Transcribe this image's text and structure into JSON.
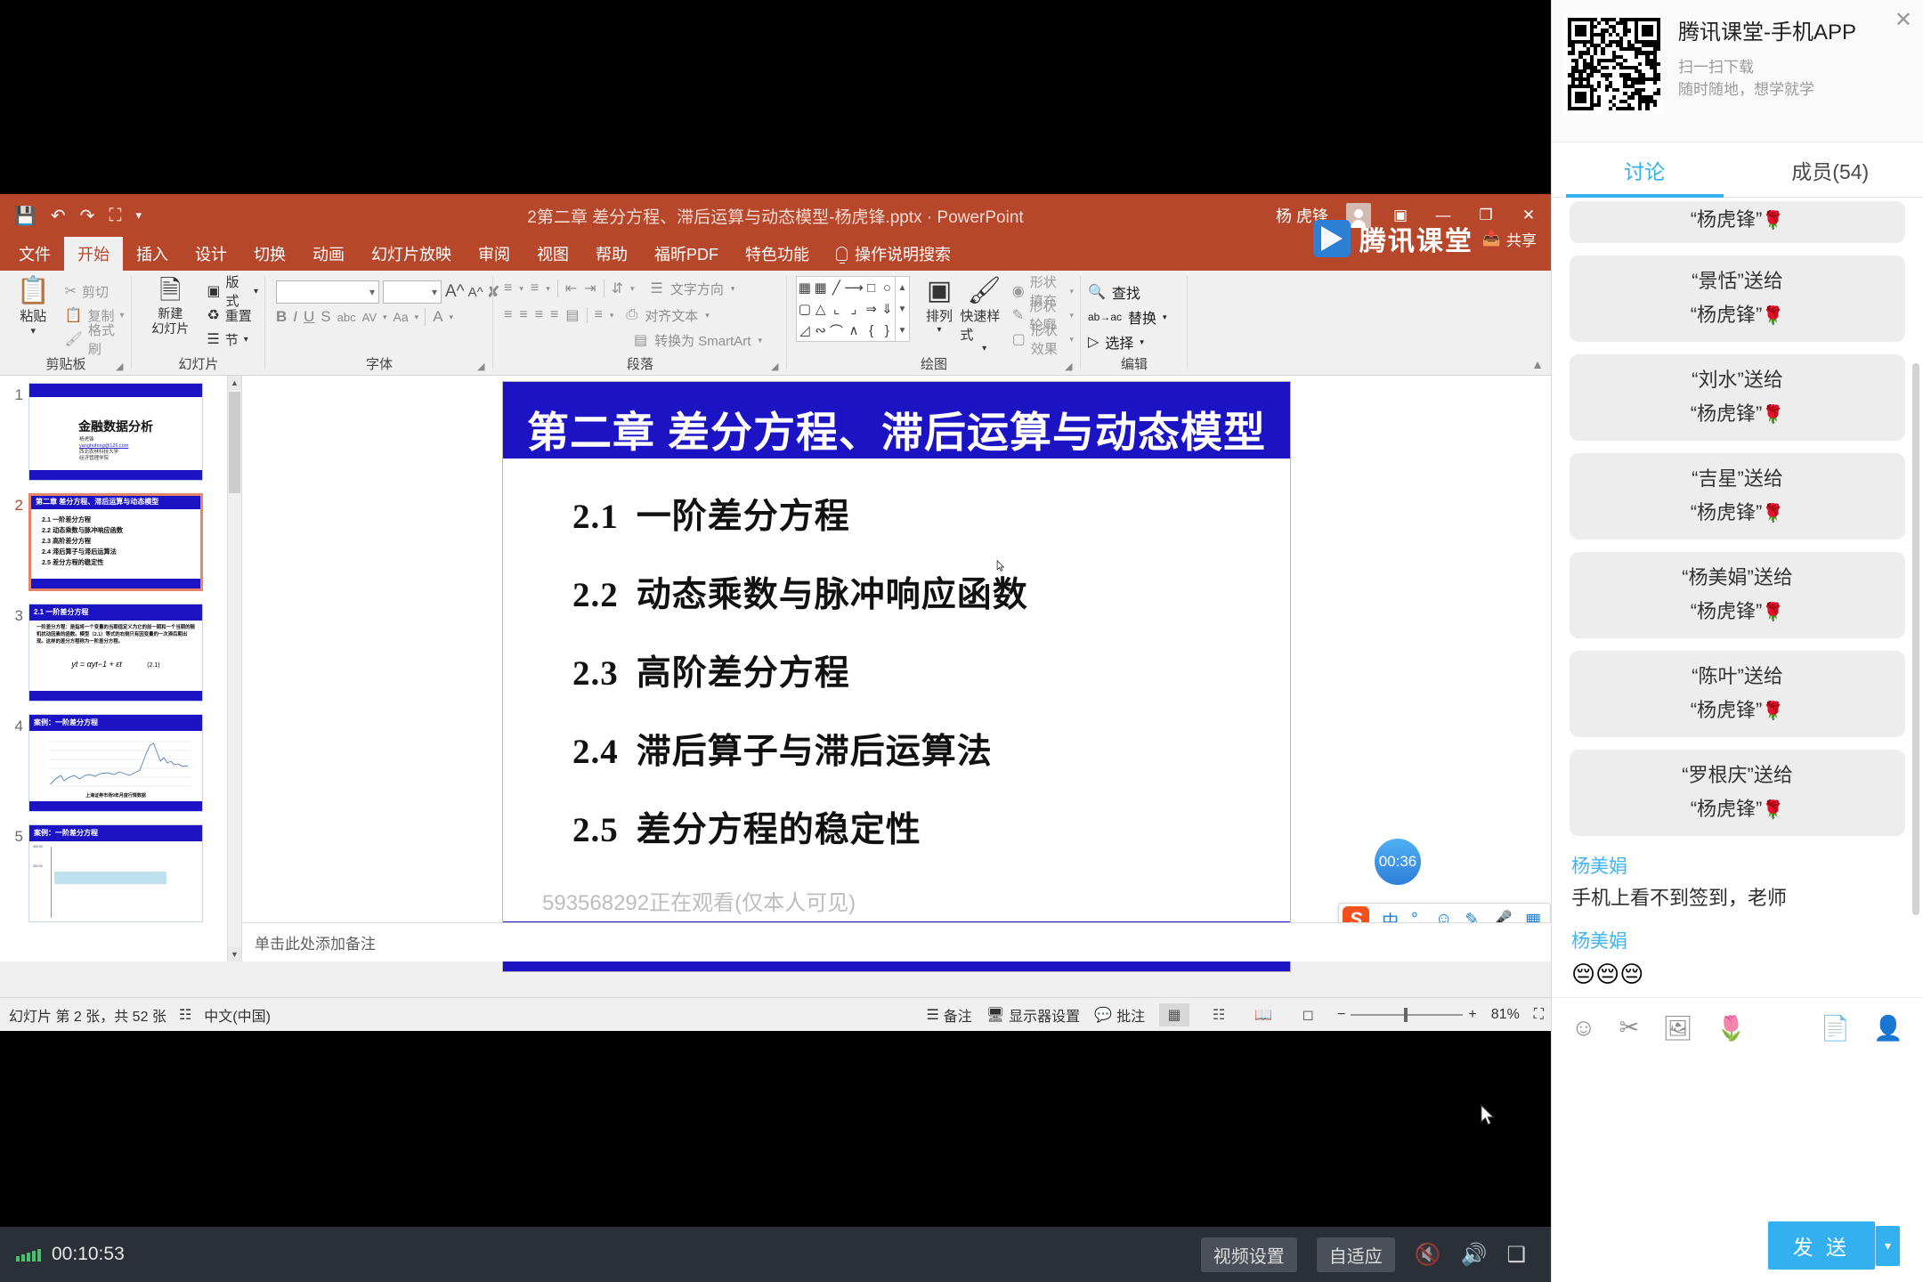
{
  "app": {
    "ppt_title": "2第二章 差分方程、滞后运算与动态模型-杨虎锋.pptx  ·  PowerPoint",
    "account_name": "杨 虎锋",
    "share_label": "共享",
    "brand_name": "腾讯课堂",
    "quick_access": [
      "save-icon",
      "undo-icon",
      "redo-icon",
      "present-icon",
      "customize-icon"
    ],
    "window_buttons": {
      "restore_down": "❐",
      "minimize": "—",
      "maximize": "❐",
      "close": "✕"
    }
  },
  "ribbon": {
    "tabs": [
      {
        "label": "文件",
        "active": false
      },
      {
        "label": "开始",
        "active": true
      },
      {
        "label": "插入",
        "active": false
      },
      {
        "label": "设计",
        "active": false
      },
      {
        "label": "切换",
        "active": false
      },
      {
        "label": "动画",
        "active": false
      },
      {
        "label": "幻灯片放映",
        "active": false
      },
      {
        "label": "审阅",
        "active": false
      },
      {
        "label": "视图",
        "active": false
      },
      {
        "label": "帮助",
        "active": false
      },
      {
        "label": "福昕PDF",
        "active": false
      },
      {
        "label": "特色功能",
        "active": false
      }
    ],
    "tell_me": "操作说明搜索",
    "groups": {
      "clipboard": {
        "label": "剪贴板",
        "paste": "粘贴",
        "cut": "剪切",
        "copy": "复制",
        "format_painter": "格式刷"
      },
      "slides": {
        "label": "幻灯片",
        "new_slide": "新建\n幻灯片",
        "new_slide_line1": "新建",
        "new_slide_line2": "幻灯片",
        "layout": "版式",
        "reset": "重置",
        "section": "节"
      },
      "font": {
        "label": "字体",
        "font_name_value": "",
        "font_size_value": "",
        "bold": "B",
        "italic": "I",
        "underline": "U",
        "shadow": "S",
        "strikethrough": "abc",
        "char_spacing": "AV",
        "change_case": "Aa",
        "font_color": "A"
      },
      "paragraph": {
        "label": "段落",
        "text_direction": "文字方向",
        "align_text": "对齐文本",
        "convert_smartart": "转换为 SmartArt"
      },
      "drawing": {
        "label": "绘图",
        "arrange": "排列",
        "quick_styles": "快速样式",
        "shape_fill": "形状填充",
        "shape_outline": "形状轮廓",
        "shape_effects": "形状效果"
      },
      "editing": {
        "label": "编辑",
        "find": "查找",
        "replace": "替换",
        "select": "选择"
      }
    }
  },
  "thumbnails": [
    {
      "number": "1",
      "selected": false,
      "type": "cover",
      "title": "金融数据分析",
      "subtitle_lines": [
        "杨虎锋",
        "yanghufeng@126.com",
        "西北农林科技大学",
        "经济管理学院"
      ]
    },
    {
      "number": "2",
      "selected": true,
      "type": "toc",
      "title": "第二章  差分方程、滞后运算与动态模型",
      "items": [
        "2.1  一阶差分方程",
        "2.2  动态乘数与脉冲响应函数",
        "2.3  高阶差分方程",
        "2.4  滞后算子与滞后运算法",
        "2.5  差分方程的稳定性"
      ]
    },
    {
      "number": "3",
      "selected": false,
      "type": "text",
      "title": "2.1  一阶差分方程",
      "paragraph": "一阶差分方程：是指将一个变量的当期值定义为它的前一期和一个当期的随机扰动因素的函数。模型（2.1）等式的右侧只有因变量的一次滞后期出现。这样的差分方程称为一阶差分方程。",
      "equation": "yt = αyt−1 + εt",
      "equation_number": "(2.1)"
    },
    {
      "number": "4",
      "selected": false,
      "type": "chart",
      "title": "案例：一阶差分方程",
      "chart_caption": "上海证券市场9年月度行情数据"
    },
    {
      "number": "5",
      "selected": false,
      "type": "chart",
      "title": "案例：一阶差分方程"
    }
  ],
  "slide": {
    "title": "第二章  差分方程、滞后运算与动态模型",
    "items": [
      {
        "num": "2.1",
        "text": "一阶差分方程"
      },
      {
        "num": "2.2",
        "text": "动态乘数与脉冲响应函数"
      },
      {
        "num": "2.3",
        "text": "高阶差分方程"
      },
      {
        "num": "2.4",
        "text": "滞后算子与滞后运算法"
      },
      {
        "num": "2.5",
        "text": "差分方程的稳定性"
      }
    ],
    "watermark": "593568292正在观看(仅本人可见)",
    "notes_placeholder": "单击此处添加备注",
    "timer_bubble": "00:36"
  },
  "ime": {
    "mode": "中",
    "punct": "°,",
    "emoji": "☺",
    "pen": "✎",
    "mic": "🎤",
    "grid": "▦"
  },
  "status_bar": {
    "slide_counter": "幻灯片 第 2 张，共 52 张",
    "language": "中文(中国)",
    "notes": "备注",
    "display_settings": "显示器设置",
    "comments": "批注",
    "zoom_level": "81%",
    "zoom_minus": "−",
    "zoom_plus": "+",
    "views": [
      "normal-view",
      "slide-sorter-view",
      "reading-view",
      "slideshow-view"
    ]
  },
  "video_bar": {
    "elapsed": "00:10:53",
    "video_settings": "视频设置",
    "fit_mode": "自适应",
    "mic_muted": true,
    "speaker_on": true,
    "exit_fullscreen": "exit-fullscreen-icon"
  },
  "chat": {
    "promo": {
      "title": "腾讯课堂-手机APP",
      "line1": "扫一扫下载",
      "line2": "随时随地，想学就学",
      "close": "✕"
    },
    "tabs": [
      {
        "label": "讨论",
        "active": true
      },
      {
        "label": "成员(54)",
        "active": false
      }
    ],
    "gifts": [
      {
        "line1": "",
        "line2": "“杨虎锋”",
        "rose": "🌹",
        "partial": true
      },
      {
        "line1": "“景恬”送给",
        "line2": "“杨虎锋”",
        "rose": "🌹"
      },
      {
        "line1": "“刘水”送给",
        "line2": "“杨虎锋”",
        "rose": "🌹"
      },
      {
        "line1": "“吉星”送给",
        "line2": "“杨虎锋”",
        "rose": "🌹"
      },
      {
        "line1": "“杨美娟”送给",
        "line2": "“杨虎锋”",
        "rose": "🌹"
      },
      {
        "line1": "“陈叶”送给",
        "line2": "“杨虎锋”",
        "rose": "🌹"
      },
      {
        "line1": "“罗根庆”送给",
        "line2": "“杨虎锋”",
        "rose": "🌹"
      }
    ],
    "messages": [
      {
        "who": "杨美娟",
        "body": "手机上看不到签到，老师"
      },
      {
        "who": "杨美娟",
        "body": "😔😔😔"
      }
    ],
    "toolbar": [
      "emoji-icon",
      "scissors-icon",
      "image-icon",
      "flower-icon",
      "card-icon",
      "person-icon"
    ],
    "input_placeholder": "",
    "send_label": "发 送",
    "send_caret": "▾"
  },
  "colors": {
    "ppt_accent": "#b7472a",
    "slide_blue": "#1b13c4",
    "chat_accent": "#33b0f0",
    "selected_thumb": "#e8846a"
  }
}
